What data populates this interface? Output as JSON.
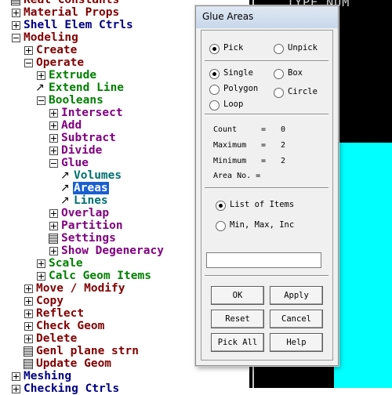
{
  "tree": {
    "items": [
      {
        "label": "Real Constants",
        "color": "#800000"
      },
      {
        "label": "Material Props",
        "color": "#800000"
      },
      {
        "label": "Shell Elem Ctrls",
        "color": "#000080"
      },
      {
        "label": "Modeling",
        "color": "#800000"
      },
      {
        "label": "Create",
        "color": "#800000"
      },
      {
        "label": "Operate",
        "color": "#800000"
      },
      {
        "label": "Extrude",
        "color": "#008000"
      },
      {
        "label": "Extend Line",
        "color": "#008000"
      },
      {
        "label": "Booleans",
        "color": "#008000"
      },
      {
        "label": "Intersect",
        "color": "#800080"
      },
      {
        "label": "Add",
        "color": "#800080"
      },
      {
        "label": "Subtract",
        "color": "#800080"
      },
      {
        "label": "Divide",
        "color": "#800080"
      },
      {
        "label": "Glue",
        "color": "#800080"
      },
      {
        "label": "Volumes",
        "color": "#007070"
      },
      {
        "label": "Areas",
        "color": "#007070",
        "selected": true
      },
      {
        "label": "Lines",
        "color": "#007070"
      },
      {
        "label": "Overlap",
        "color": "#800080"
      },
      {
        "label": "Partition",
        "color": "#800080"
      },
      {
        "label": "Settings",
        "color": "#800080"
      },
      {
        "label": "Show Degeneracy",
        "color": "#800080"
      },
      {
        "label": "Scale",
        "color": "#008000"
      },
      {
        "label": "Calc Geom Items",
        "color": "#008000"
      },
      {
        "label": "Move / Modify",
        "color": "#800000"
      },
      {
        "label": "Copy",
        "color": "#800000"
      },
      {
        "label": "Reflect",
        "color": "#800000"
      },
      {
        "label": "Check Geom",
        "color": "#800000"
      },
      {
        "label": "Delete",
        "color": "#800000"
      },
      {
        "label": "Genl plane strn",
        "color": "#800000"
      },
      {
        "label": "Update Geom",
        "color": "#800000"
      },
      {
        "label": "Meshing",
        "color": "#000080"
      },
      {
        "label": "Checking Ctrls",
        "color": "#000080"
      }
    ]
  },
  "graphics": {
    "header_text": "TYPE NUM",
    "background_color": "#000000",
    "fill_color": "#00ffff"
  },
  "dialog": {
    "title": "Glue Areas",
    "pick_label": "Pick",
    "unpick_label": "Unpick",
    "single_label": "Single",
    "box_label": "Box",
    "polygon_label": "Polygon",
    "circle_label": "Circle",
    "loop_label": "Loop",
    "count_label": "Count",
    "count_value": "0",
    "maximum_label": "Maximum",
    "maximum_value": "2",
    "minimum_label": "Minimum",
    "minimum_value": "2",
    "area_no_label": "Area No. =",
    "list_items_label": "List of Items",
    "min_max_label": "Min, Max, Inc",
    "input_value": "",
    "ok_label": "OK",
    "apply_label": "Apply",
    "reset_label": "Reset",
    "cancel_label": "Cancel",
    "pick_all_label": "Pick All",
    "help_label": "Help"
  }
}
